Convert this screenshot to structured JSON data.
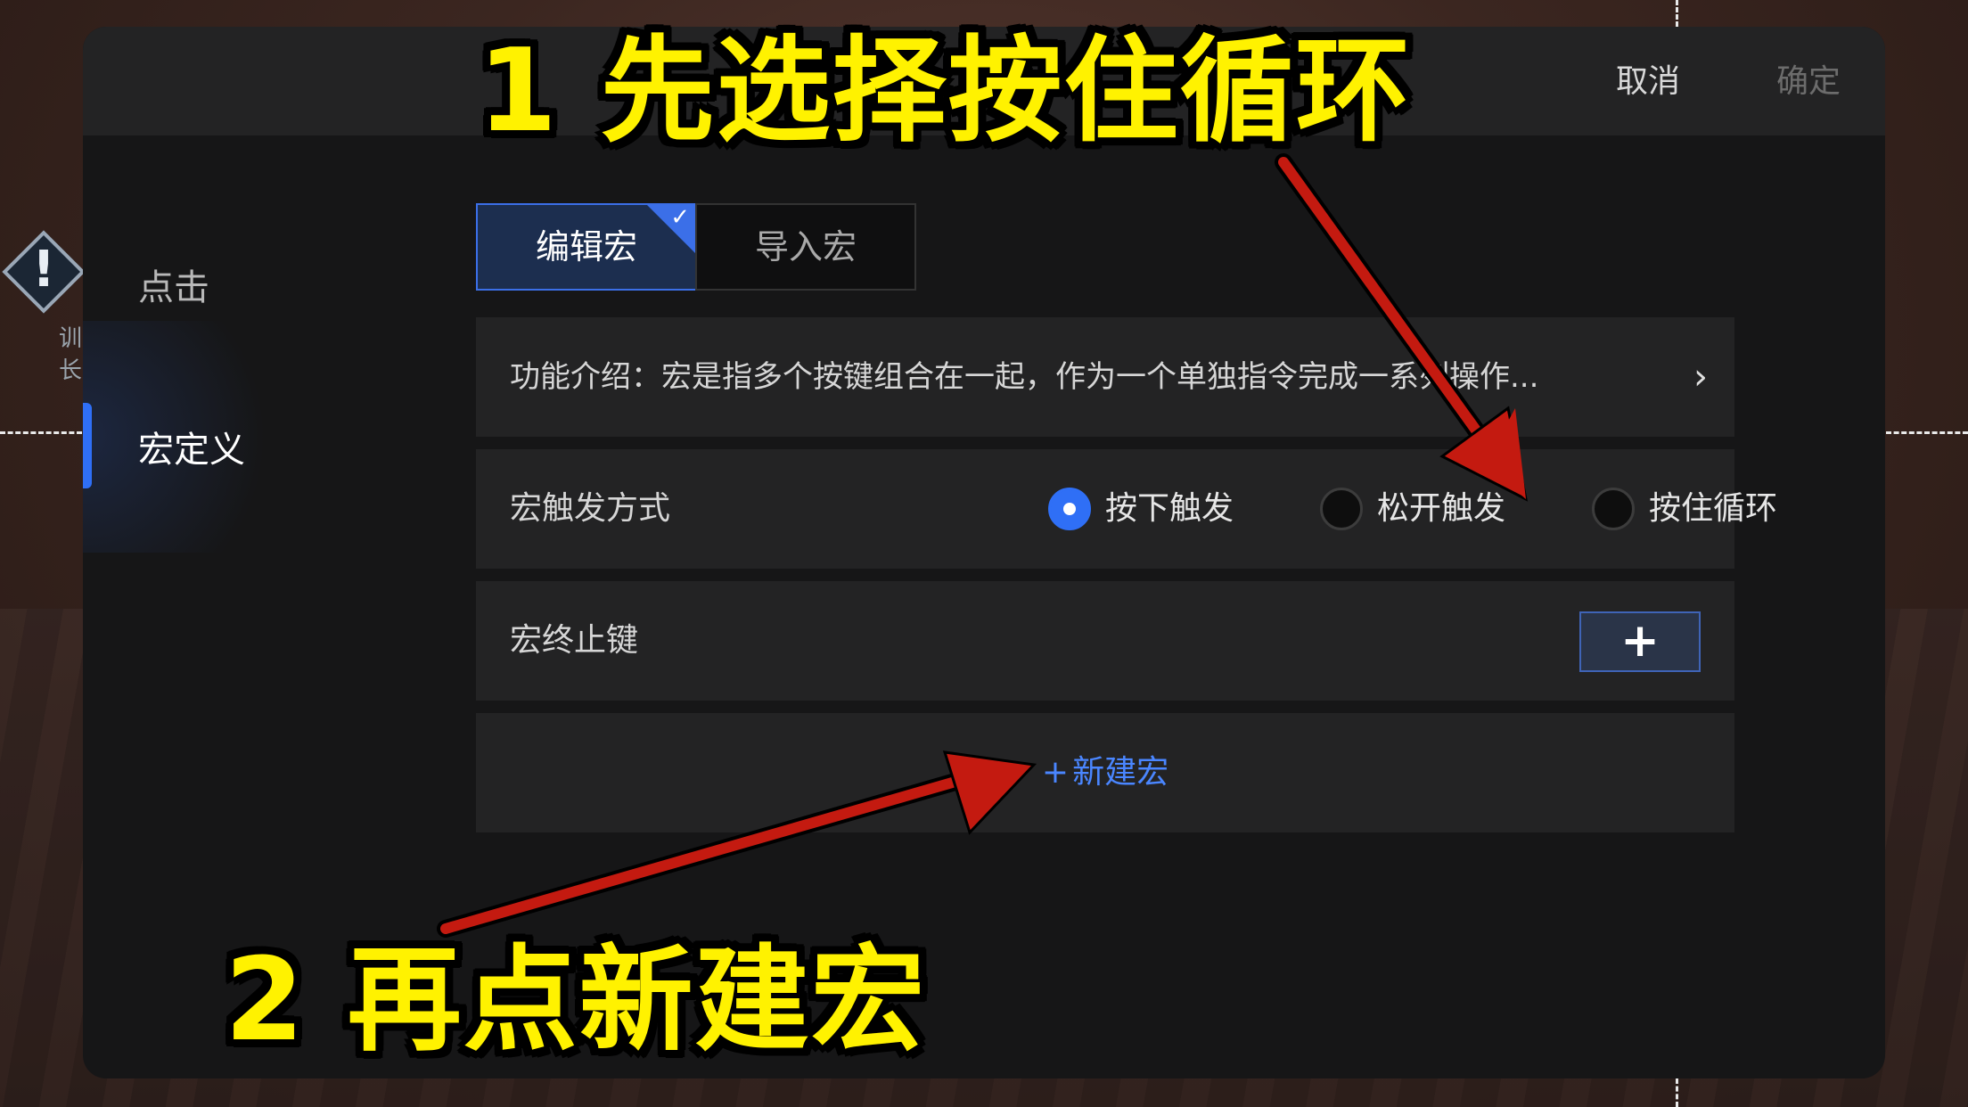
{
  "background": {
    "hint_lines": [
      "训",
      "长"
    ]
  },
  "header": {
    "cancel_label": "取消",
    "confirm_label": "确定"
  },
  "sidebar": {
    "items": [
      {
        "label": "点击",
        "active": false
      },
      {
        "label": "宏定义",
        "active": true
      }
    ]
  },
  "tabs": [
    {
      "label": "编辑宏",
      "selected": true
    },
    {
      "label": "导入宏",
      "selected": false
    }
  ],
  "intro": {
    "text": "功能介绍：宏是指多个按键组合在一起，作为一个单独指令完成一系列操作..."
  },
  "trigger": {
    "label": "宏触发方式",
    "options": [
      {
        "label": "按下触发",
        "selected": true
      },
      {
        "label": "松开触发",
        "selected": false
      },
      {
        "label": "按住循环",
        "selected": false
      }
    ]
  },
  "stop_key": {
    "label": "宏终止键",
    "add_label": "+"
  },
  "new_macro": {
    "plus": "+",
    "label": "新建宏"
  },
  "annotations": {
    "step1": "1 先选择按住循环",
    "step2": "2  再点新建宏"
  },
  "colors": {
    "accent": "#2f6ff6",
    "link": "#4a86ff",
    "annotation_text": "#fff200",
    "arrow": "#c41a10"
  }
}
